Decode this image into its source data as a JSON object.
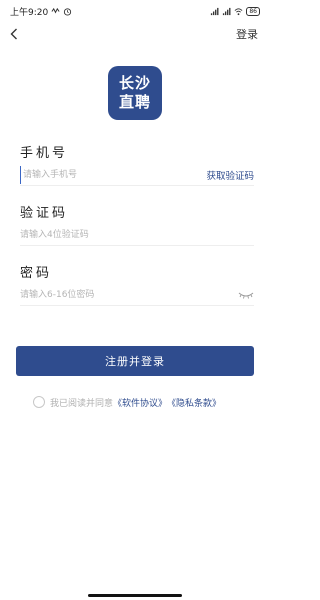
{
  "status_bar": {
    "time": "上午9:20",
    "battery": "86",
    "icons": [
      "signal-icon",
      "signal-icon",
      "wifi-icon",
      "battery-icon",
      "notification-icon",
      "alarm-icon"
    ]
  },
  "nav": {
    "back_icon": "chevron-left-icon",
    "login_label": "登录"
  },
  "logo": {
    "line1": "长沙",
    "line2": "直聘",
    "color": "#2f4c8e"
  },
  "form": {
    "phone": {
      "label": "手机号",
      "value": "",
      "placeholder": "请输入手机号",
      "code_button": "获取验证码"
    },
    "code": {
      "label": "验证码",
      "value": "",
      "placeholder": "请输入4位验证码"
    },
    "password": {
      "label": "密码",
      "value": "",
      "placeholder": "请输入6-16位密码",
      "toggle_icon": "eye-closed-icon"
    },
    "submit_label": "注册并登录"
  },
  "agreement": {
    "checked": false,
    "text": "我已阅读并同意",
    "software_link": "《软件协议》",
    "privacy_link": "《隐私条款》"
  },
  "colors": {
    "accent": "#2f4c8e",
    "placeholder": "#b5b5b5",
    "divider": "#eeeeee"
  }
}
